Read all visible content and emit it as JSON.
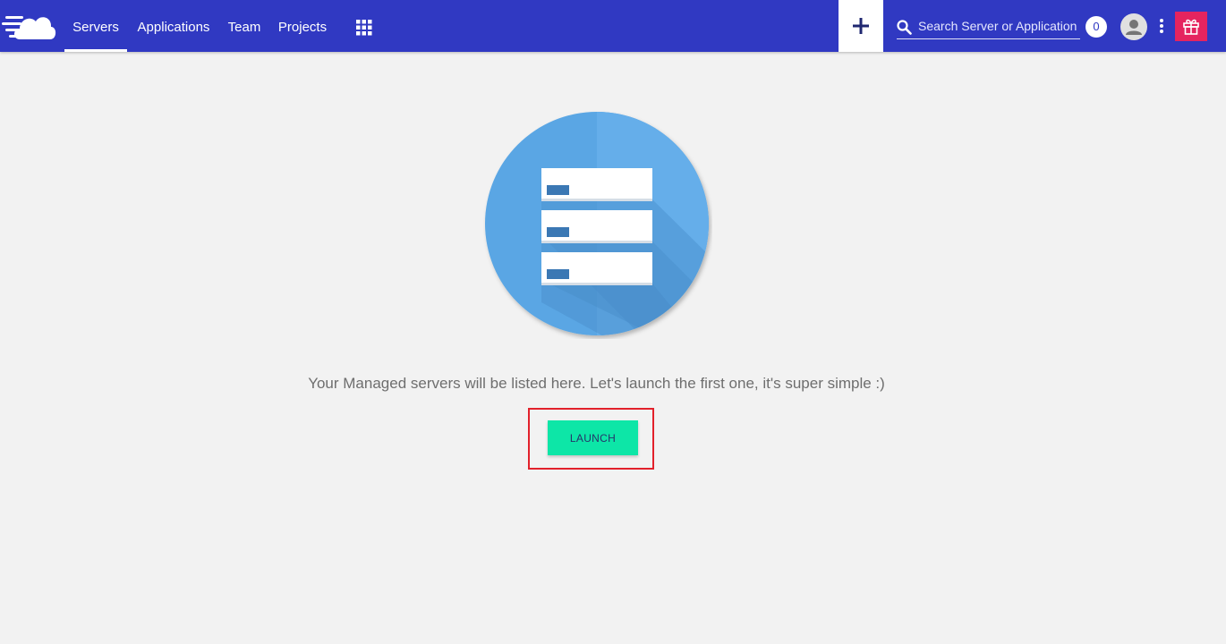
{
  "nav": {
    "items": [
      {
        "label": "Servers",
        "active": true
      },
      {
        "label": "Applications",
        "active": false
      },
      {
        "label": "Team",
        "active": false
      },
      {
        "label": "Projects",
        "active": false
      }
    ],
    "apps_icon": "grid-icon"
  },
  "header": {
    "logo_icon": "cloud-logo-icon",
    "add_icon": "plus-icon",
    "search": {
      "placeholder": "Search Server or Application",
      "value": ""
    },
    "notifications_count": "0",
    "avatar_icon": "user-icon",
    "menu_icon": "kebab-menu-icon",
    "gift_icon": "gift-icon"
  },
  "main": {
    "empty_message": "Your Managed servers will be listed here. Let's launch the first one, it's super simple :)",
    "launch_label": "LAUNCH"
  },
  "colors": {
    "header_bg": "#3039c2",
    "launch_button": "#0de6a7",
    "gift_button": "#e5245f",
    "illustration_circle": "#5aa6e4",
    "highlight_box": "#e2212b"
  }
}
